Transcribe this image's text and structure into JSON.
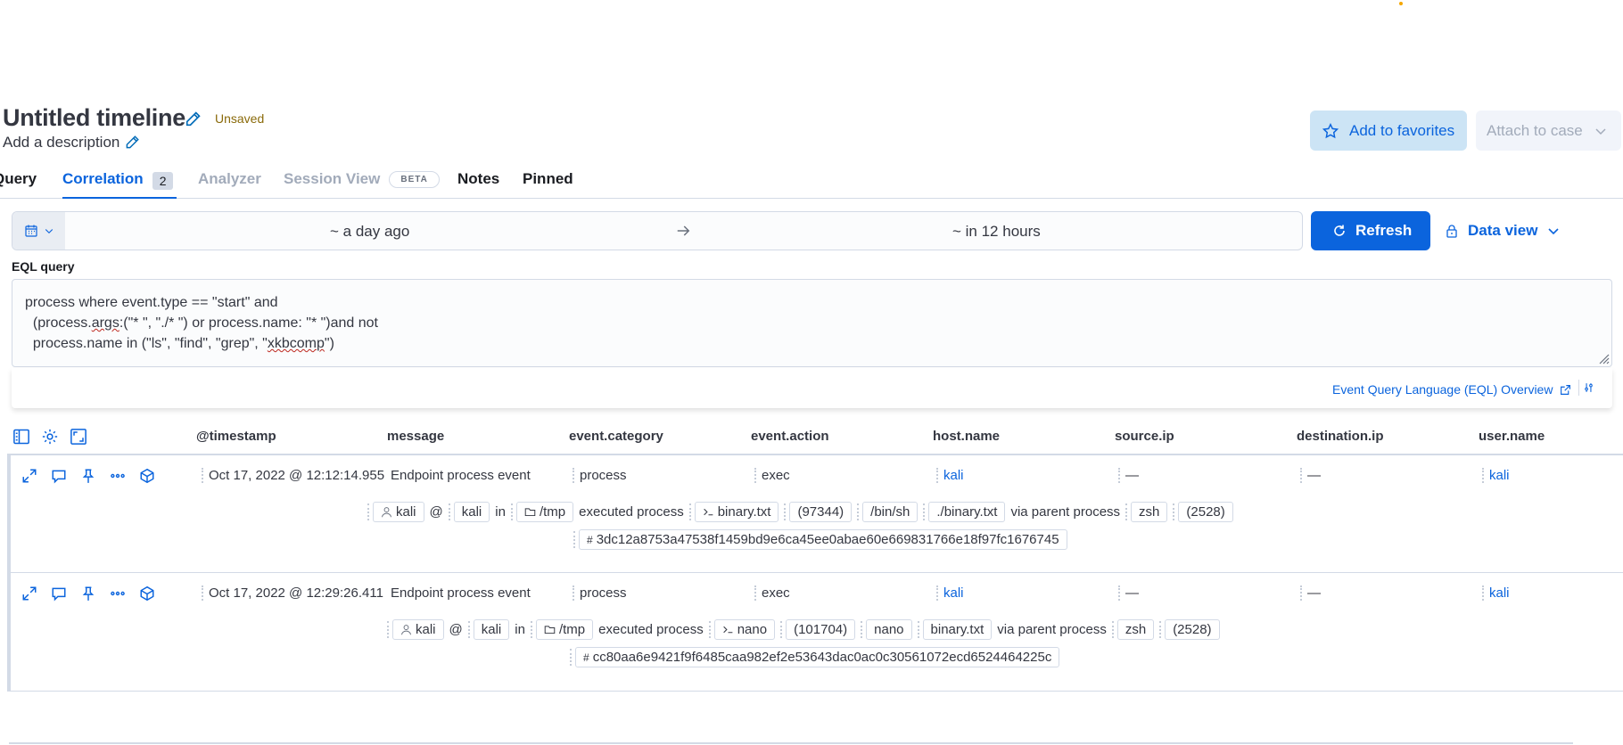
{
  "header": {
    "title": "Untitled timeline",
    "status": "Unsaved",
    "description": "Add a description",
    "favorite_button": "Add to favorites",
    "attach_button": "Attach to case"
  },
  "tabs": [
    {
      "label": "Query"
    },
    {
      "label": "Correlation",
      "count": "2"
    },
    {
      "label": "Analyzer"
    },
    {
      "label": "Session View",
      "badge": "BETA"
    },
    {
      "label": "Notes"
    },
    {
      "label": "Pinned"
    }
  ],
  "datepicker": {
    "start": "~ a day ago",
    "end": "~ in 12 hours",
    "refresh_label": "Refresh",
    "data_view_label": "Data view"
  },
  "eql": {
    "label": "EQL query",
    "line1": "process where event.type == \"start\" and",
    "line2_pre": "  (process.",
    "line2_flag": "args",
    "line2_post": ":(\"* \", \"./* \") or process.name: \"* \")and not",
    "line3_pre": "  process.name in (\"ls\", \"find\", \"grep\", \"",
    "line3_flag": "xkbcomp",
    "line3_post": "\")",
    "overview_link": "Event Query Language (EQL) Overview"
  },
  "table": {
    "columns": [
      "@timestamp",
      "message",
      "event.category",
      "event.action",
      "host.name",
      "source.ip",
      "destination.ip",
      "user.name"
    ],
    "rows": [
      {
        "timestamp": "Oct 17, 2022 @ 12:12:14.955",
        "message": "Endpoint process event",
        "category": "process",
        "action": "exec",
        "host": "kali",
        "source_ip": "—",
        "dest_ip": "—",
        "user": "kali",
        "summary": {
          "user": "kali",
          "at": "@",
          "host": "kali",
          "in": "in",
          "dir": "/tmp",
          "verb": "executed process",
          "process": "binary.txt",
          "pid": "(97344)",
          "exe": "/bin/sh",
          "args": "./binary.txt",
          "via": "via parent process",
          "parent": "zsh",
          "ppid": "(2528)",
          "hash": "3dc12a8753a47538f1459bd9e6ca45ee0abae60e669831766e18f97fc1676745"
        }
      },
      {
        "timestamp": "Oct 17, 2022 @ 12:29:26.411",
        "message": "Endpoint process event",
        "category": "process",
        "action": "exec",
        "host": "kali",
        "source_ip": "—",
        "dest_ip": "—",
        "user": "kali",
        "summary": {
          "user": "kali",
          "at": "@",
          "host": "kali",
          "in": "in",
          "dir": "/tmp",
          "verb": "executed process",
          "process": "nano",
          "pid": "(101704)",
          "exe": "nano",
          "args": "binary.txt",
          "via": "via parent process",
          "parent": "zsh",
          "ppid": "(2528)",
          "hash": "cc80aa6e9421f9f6485caa982ef2e53643dac0ac0c30561072ecd6524464225c"
        }
      }
    ]
  },
  "colors": {
    "accent": "#0b64dd",
    "warning_text": "#8a6a0a",
    "border": "#d3dae6"
  }
}
